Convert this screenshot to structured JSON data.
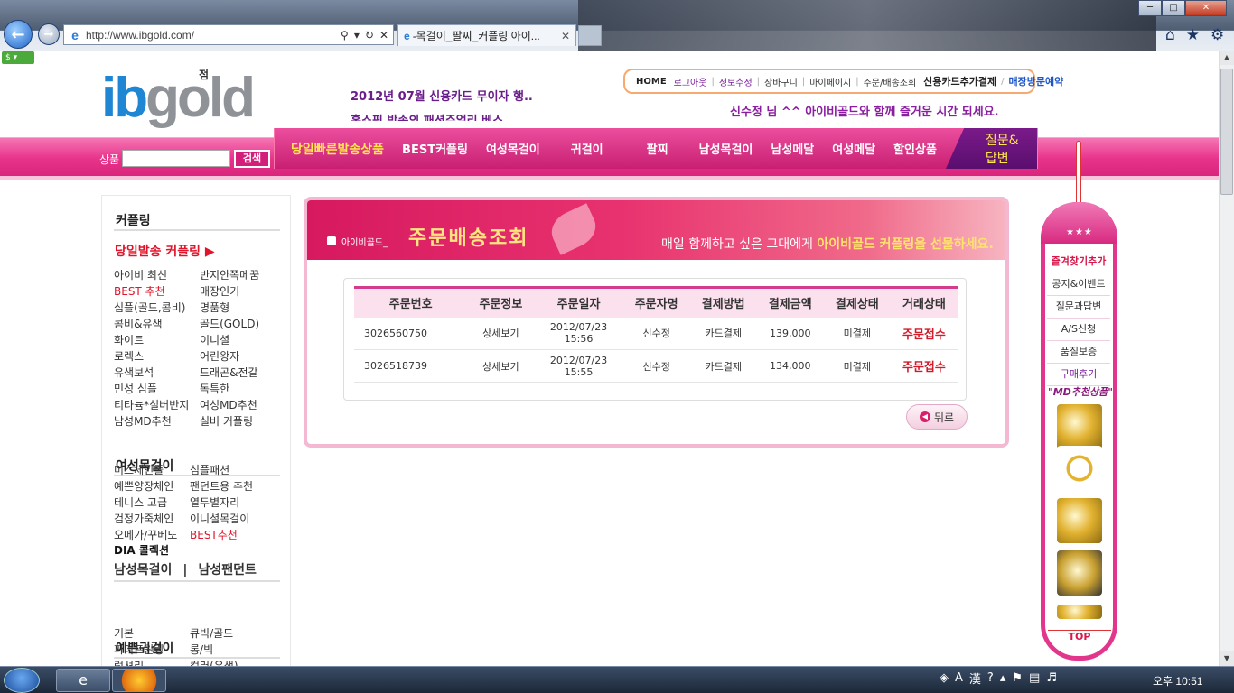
{
  "browser": {
    "url": "http://www.ibgold.com/",
    "tab_title": "-목걸이_팔찌_커플링 아이...",
    "status_badge": "$ ▾",
    "win_min": "─",
    "win_max": "□",
    "win_close": "✕",
    "home_icon": "⌂",
    "fav_icon": "★",
    "gear_icon": "⚙"
  },
  "header": {
    "logo_ib": "ib",
    "logo_gold": "gold",
    "logo_tag": "점",
    "notice_1": "2012년 07월 신용카드 무이자 행..",
    "notice_2": "홈쇼핑 방송의 패션쥬얼리 베스..",
    "welcome": "신수정 님 ^^ 아이비골드와 함께 즐거운 시간 되세요.",
    "top_menu": {
      "home": "HOME",
      "logout": "로그아웃",
      "edit_info": "정보수정",
      "cart": "장바구니",
      "mypage": "마이페이지",
      "orders": "주문/배송조회",
      "card_pay": "신용카드추가결제",
      "visit": "매장방문예약"
    }
  },
  "search": {
    "label": "상품",
    "button": "검색",
    "value": ""
  },
  "main_nav": {
    "items": [
      "당일빠른발송상품",
      "BEST커플링",
      "여성목걸이",
      "귀걸이",
      "팔찌",
      "남성목걸이",
      "남성메달",
      "여성메달",
      "할인상품"
    ],
    "qa": "질문&답변"
  },
  "sidebar": {
    "section1_title": "커플링",
    "hot_link": "당일발송 커플링 ▶",
    "couple_items": [
      "아이비 최신",
      "반지안쪽메꿈",
      "BEST 추천",
      "매장인기",
      "심플(골드,콤비)",
      "명품형",
      "콤비&유색",
      "골드(GOLD)",
      "화이트",
      "이니셜",
      "로렉스",
      "어린왕자",
      "유색보석",
      "드래곤&전갈",
      "민성 심플",
      "독특한",
      "티타늄*실버반지",
      "여성MD추천",
      "남성MD추천",
      "실버 커플링"
    ],
    "section2_title": "여성목걸이",
    "necklace_items": [
      "미스체인줄",
      "심플패션",
      "예쁜양장체인",
      "팬던트용 추천",
      "테니스 고급",
      "열두별자리",
      "검정가죽체인",
      "이니셜목걸이",
      "오메가/꾸베또",
      "BEST추천"
    ],
    "dia": "DIA 콜렉션",
    "men_necklace": "남성목걸이",
    "men_divider": "|",
    "men_pendant": "남성팬던트",
    "section3_title": "예쁜귀걸이",
    "earring_items": [
      "기본",
      "큐빅/골드",
      "파이프원링",
      "롱/빅",
      "럭셔리",
      "컬러(유색)"
    ]
  },
  "order_panel": {
    "banner_label": "아이비골드_",
    "banner_title": "주문배송조회",
    "banner_sub": "매일 함께하고 싶은 그대에게 ",
    "banner_sub2": "아이비골드 커플링을 선물하세요.",
    "columns": [
      "주문번호",
      "주문정보",
      "주문일자",
      "주문자명",
      "결제방법",
      "결제금액",
      "결제상태",
      "거래상태"
    ],
    "rows": [
      {
        "order_no": "3026560750",
        "info": "상세보기",
        "date": "2012/07/23",
        "time": "15:56",
        "name": "신수정",
        "method": "카드결제",
        "amount": "139,000",
        "pay_status": "미결제",
        "trade_status": "주문접수"
      },
      {
        "order_no": "3026518739",
        "info": "상세보기",
        "date": "2012/07/23",
        "time": "15:55",
        "name": "신수정",
        "method": "카드결제",
        "amount": "134,000",
        "pay_status": "미결제",
        "trade_status": "주문접수"
      }
    ],
    "back_button": "뒤로"
  },
  "quick_bar": {
    "stars": "★★★",
    "links": [
      "즐겨찾기추가",
      "공지&이벤트",
      "질문과답변",
      "A/S신청",
      "품질보증",
      "구매후기"
    ],
    "md_title": "\"MD추천상품\"",
    "top": "TOP"
  },
  "taskbar": {
    "clock": "오후 10:51",
    "ime_a": "A",
    "ime_han": "漢",
    "help": "?"
  }
}
